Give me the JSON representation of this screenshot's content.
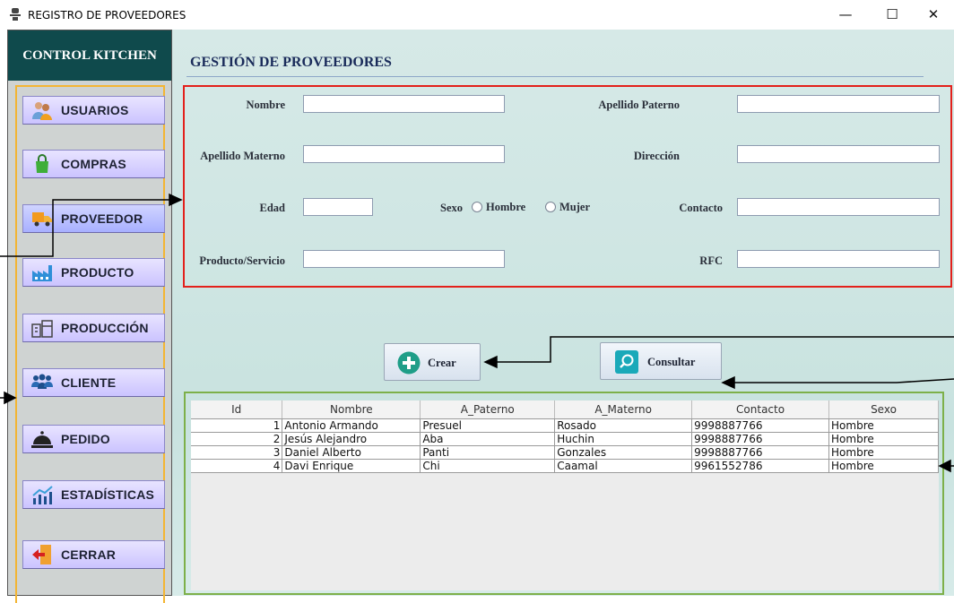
{
  "window": {
    "title": "REGISTRO DE PROVEEDORES",
    "minimize": "—",
    "maximize": "☐",
    "close": "✕"
  },
  "sidebar": {
    "brand": "CONTROL KITCHEN",
    "items": [
      {
        "label": "USUARIOS",
        "icon": "users-icon"
      },
      {
        "label": "COMPRAS",
        "icon": "shopping-bag-icon"
      },
      {
        "label": "PROVEEDOR",
        "icon": "truck-icon"
      },
      {
        "label": "PRODUCTO",
        "icon": "factory-icon"
      },
      {
        "label": "PRODUCCIÓN",
        "icon": "production-icon"
      },
      {
        "label": "CLIENTE",
        "icon": "clients-icon"
      },
      {
        "label": "PEDIDO",
        "icon": "cloche-icon"
      },
      {
        "label": "ESTADÍSTICAS",
        "icon": "chart-icon"
      },
      {
        "label": "CERRAR",
        "icon": "exit-icon"
      }
    ]
  },
  "main": {
    "title": "GESTIÓN DE PROVEEDORES",
    "form": {
      "nombre": {
        "label": "Nombre",
        "value": ""
      },
      "apellido_paterno": {
        "label": "Apellido Paterno",
        "value": ""
      },
      "apellido_materno": {
        "label": "Apellido Materno",
        "value": ""
      },
      "direccion": {
        "label": "Dirección",
        "value": ""
      },
      "edad": {
        "label": "Edad",
        "value": ""
      },
      "sexo": {
        "label": "Sexo",
        "options": [
          "Hombre",
          "Mujer"
        ]
      },
      "contacto": {
        "label": "Contacto",
        "value": ""
      },
      "producto": {
        "label": "Producto/Servicio",
        "value": ""
      },
      "rfc": {
        "label": "RFC",
        "value": ""
      }
    },
    "buttons": {
      "crear": "Crear",
      "consultar": "Consultar"
    },
    "table": {
      "columns": [
        "Id",
        "Nombre",
        "A_Paterno",
        "A_Materno",
        "Contacto",
        "Sexo"
      ],
      "rows": [
        [
          "1",
          "Antonio Armando",
          "Presuel",
          "Rosado",
          "9998887766",
          "Hombre"
        ],
        [
          "2",
          "Jesús Alejandro",
          "Aba",
          "Huchin",
          "9998887766",
          "Hombre"
        ],
        [
          "3",
          "Daniel Alberto",
          "Panti",
          "Gonzales",
          "9998887766",
          "Hombre"
        ],
        [
          "4",
          "Davi Enrique",
          "Chi",
          "Caamal",
          "9961552786",
          "Hombre"
        ]
      ]
    }
  },
  "colors": {
    "brand": "#0f4a4c",
    "menu_frame": "#f3b533",
    "form_frame": "#e3201b",
    "table_frame": "#7db04a"
  }
}
